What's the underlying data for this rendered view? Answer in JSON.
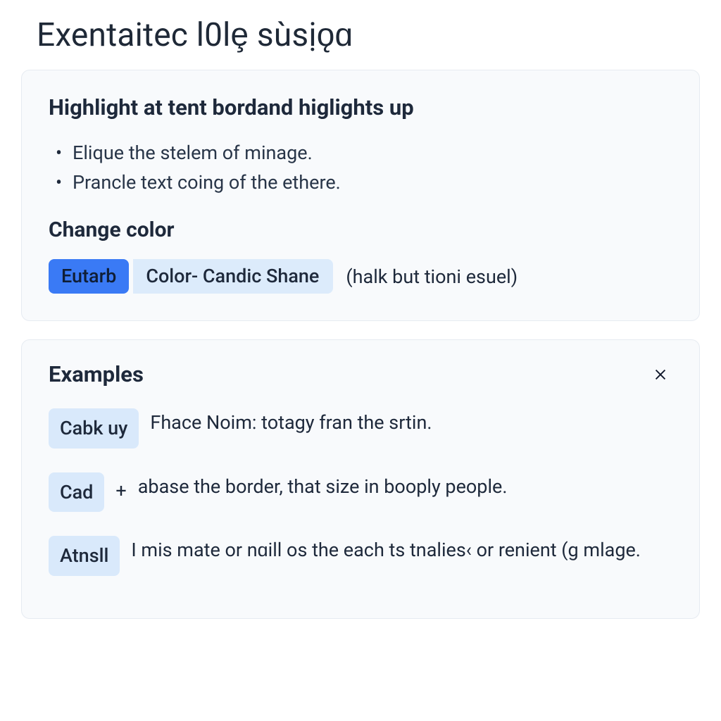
{
  "page_title": "Exentaitec l0lȩ sùsịǫɑ",
  "highlight_card": {
    "heading": "Highlight at tent bordand higlights up",
    "bullets": [
      "Elique the stelem of minage.",
      "Prancle text coing of the ethere."
    ],
    "change_color_heading": "Change color",
    "chip_primary": "Eutarb",
    "chip_secondary": "Color- Candic Shane",
    "chip_note": "(halk but tioni esuel)"
  },
  "examples_card": {
    "heading": "Examples",
    "close_icon": "close-icon",
    "rows": [
      {
        "tag": "Cabk uy",
        "plus": "",
        "text": "Fhace Noim: totagy fran the srtin."
      },
      {
        "tag": "Cad",
        "plus": "+",
        "text": "abase the border, that size in booply people."
      },
      {
        "tag": "Atnsll",
        "plus": "",
        "text": "I mis mate or nɑill os the each ts tnalies‹ or renient  (g mlage.",
        "tag2": ""
      }
    ]
  }
}
